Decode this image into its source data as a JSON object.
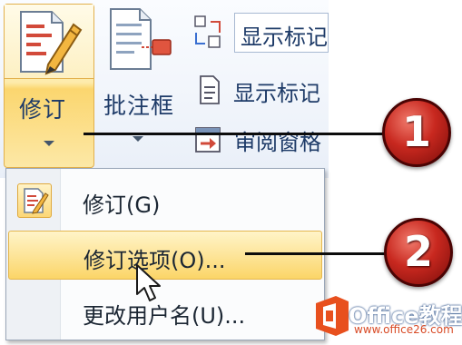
{
  "ribbon": {
    "track_button": {
      "label": "修订",
      "icon": "pencil-document-icon"
    },
    "balloons_button": {
      "label": "批注框",
      "icon": "document-comment-icon"
    },
    "display_combo": {
      "value": "显示标记",
      "icon": "markup-swap-icon"
    },
    "show_markup": {
      "label": "显示标记",
      "icon": "document-icon"
    },
    "review_pane": {
      "label": "审阅窗格",
      "icon": "pane-arrow-icon"
    }
  },
  "menu": {
    "items": [
      {
        "label": "修订(G)",
        "icon": "pencil-document-icon",
        "highlighted": false
      },
      {
        "label": "修订选项(O)...",
        "highlighted": true
      },
      {
        "label": "更改用户名(U)...",
        "highlighted": false
      }
    ]
  },
  "callouts": [
    {
      "number": "1"
    },
    {
      "number": "2"
    }
  ],
  "watermark": {
    "title": "Office教程网",
    "url": "www.office26.com"
  },
  "colors": {
    "highlight": "#fde59a",
    "badge": "#c8281f",
    "text": "#1e3b68"
  }
}
